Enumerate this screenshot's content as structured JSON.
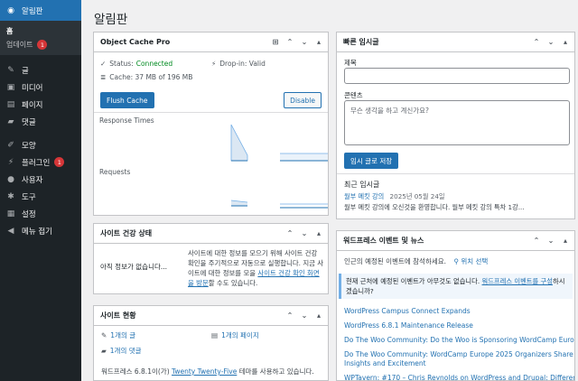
{
  "sidebar": {
    "dashboard": "알림판",
    "home": "홈",
    "updates": "업데이트",
    "updates_count": "1",
    "posts": "글",
    "media": "미디어",
    "pages": "페이지",
    "comments": "댓글",
    "appearance": "모양",
    "plugins": "플러그인",
    "plugins_count": "1",
    "users": "사용자",
    "tools": "도구",
    "settings": "설정",
    "collapse": "메뉴 접기"
  },
  "page": {
    "title": "알림판"
  },
  "object_cache": {
    "title": "Object Cache Pro",
    "status_label": "Status:",
    "status_value": "Connected",
    "dropin": "Drop-in: Valid",
    "cache": "Cache: 37 MB of 196 MB",
    "flush": "Flush Cache",
    "disable": "Disable",
    "response_times": "Response Times",
    "requests": "Requests"
  },
  "site_health": {
    "title": "사이트 건강 상태",
    "no_info": "아직 정보가 없습니다...",
    "desc_pre": "사이트에 대한 정보를 모으기 위해 사이트 건강 확인을 주기적으로 자동으로 실행합니다. 지금 사이트에 대한 정보를 모을 ",
    "desc_link": "사이트 건강 확인 화면을 방문",
    "desc_post": "할 수도 있습니다."
  },
  "glance": {
    "title": "사이트 현황",
    "posts": "1개의 글",
    "pages": "1개의 페이지",
    "comments": "1개의 댓글",
    "footer_pre": "워드프레스 6.8.1이(가) ",
    "theme": "Twenty Twenty-Five",
    "footer_post": " 테마를 사용하고 있습니다."
  },
  "quick_draft": {
    "title": "빠른 임시글",
    "title_label": "제목",
    "content_label": "콘텐츠",
    "content_placeholder": "무슨 생각을 하고 계신가요?",
    "save": "임시 글로 저장",
    "recent_heading": "최근 임시글",
    "draft_title": "월부 메킷 강의",
    "draft_date": "2025년 05월 24일",
    "draft_excerpt": "월부 메킷 강의에 오신것을 환영합니다. 월부 메킷 강의 특차 1강..."
  },
  "events": {
    "title": "워드프레스 이벤트 및 뉴스",
    "intro": "인근의 예정된 이벤트에 참석하세요.",
    "location": "위치 선택",
    "notice_pre": "현재 근처에 예정된 이벤트가 아무것도 없습니다. ",
    "notice_link": "워드프레스 이벤트를 구성",
    "notice_post": "하시겠습니까?",
    "news": [
      "WordPress Campus Connect Expands",
      "WordPress 6.8.1 Maintenance Release",
      "Do The Woo Community: Do the Woo is Sponsoring WordCamp Europe 2025",
      "Do The Woo Community: WordCamp Europe 2025 Organizers Share Insights and Excitement",
      "WPTavern: #170 – Chris Reynolds on WordPress and Drupal: Differences and"
    ]
  }
}
